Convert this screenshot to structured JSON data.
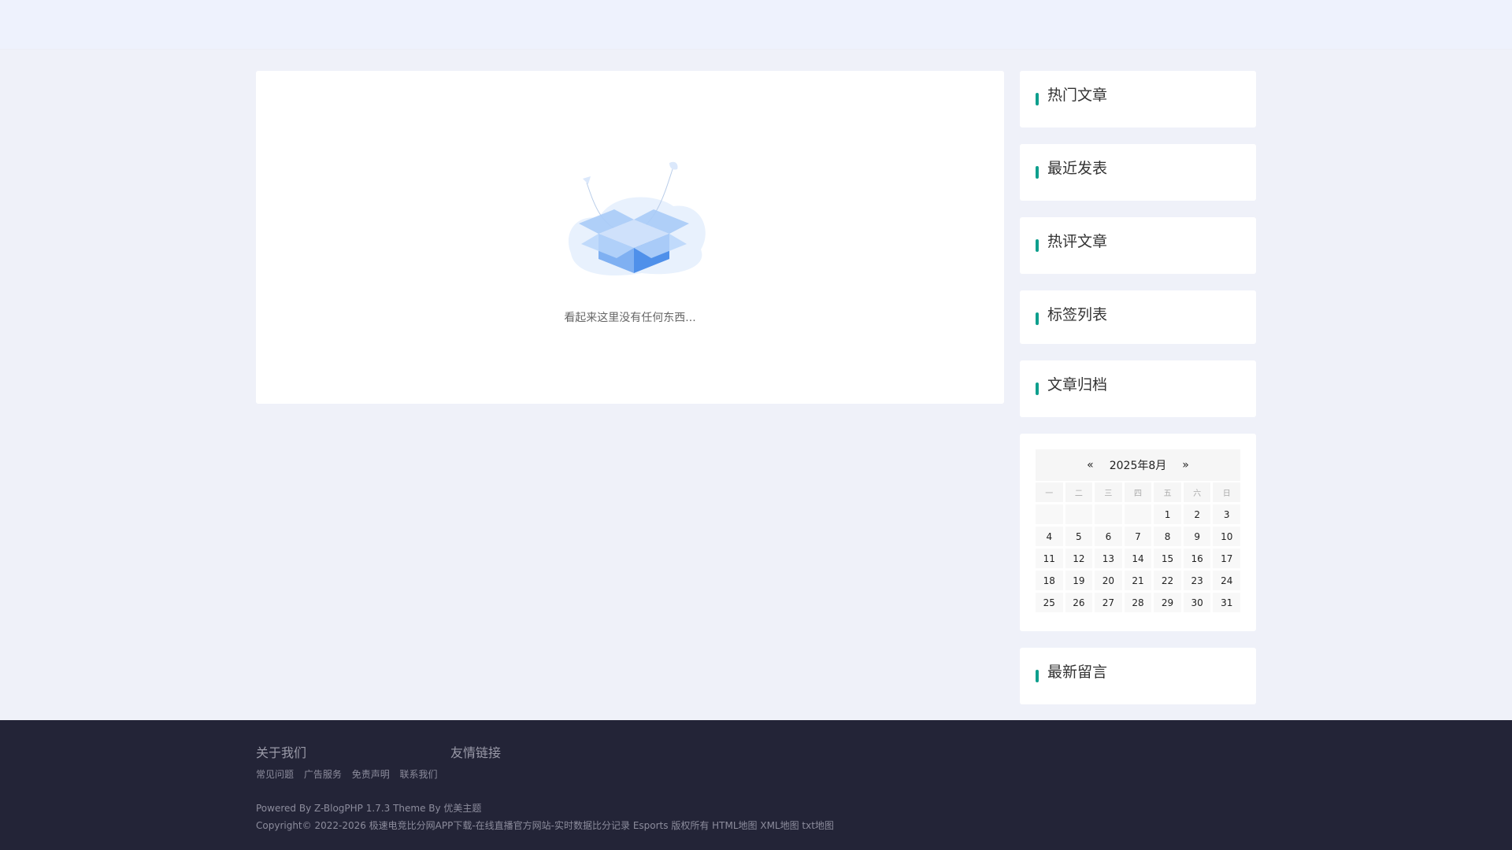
{
  "empty": {
    "message": "看起来这里没有任何东西..."
  },
  "sidebar": {
    "widgets": [
      {
        "title": "热门文章"
      },
      {
        "title": "最近发表"
      },
      {
        "title": "热评文章"
      },
      {
        "title": "标签列表"
      },
      {
        "title": "文章归档"
      }
    ],
    "calendar": {
      "prev": "«",
      "month": "2025年8月",
      "next": "»",
      "weekdays": [
        "一",
        "二",
        "三",
        "四",
        "五",
        "六",
        "日"
      ],
      "days": [
        "",
        "",
        "",
        "",
        "1",
        "2",
        "3",
        "4",
        "5",
        "6",
        "7",
        "8",
        "9",
        "10",
        "11",
        "12",
        "13",
        "14",
        "15",
        "16",
        "17",
        "18",
        "19",
        "20",
        "21",
        "22",
        "23",
        "24",
        "25",
        "26",
        "27",
        "28",
        "29",
        "30",
        "31"
      ]
    },
    "latest_comments": {
      "title": "最新留言"
    }
  },
  "footer": {
    "about_title": "关于我们",
    "links_title": "友情链接",
    "links": [
      "常见问题",
      "广告服务",
      "免责声明",
      "联系我们"
    ],
    "powered": "Powered By Z-BlogPHP 1.7.3   Theme By  优美主题",
    "copyright": "Copyright© 2022-2026 极速电竞比分网APP下载-在线直播官方网站-实时数据比分记录 Esports 版权所有 HTML地图 XML地图 txt地图"
  },
  "colors": {
    "accent": "#0e9f8d",
    "footer_bg": "#232437",
    "page_bg": "#eff1f9"
  }
}
